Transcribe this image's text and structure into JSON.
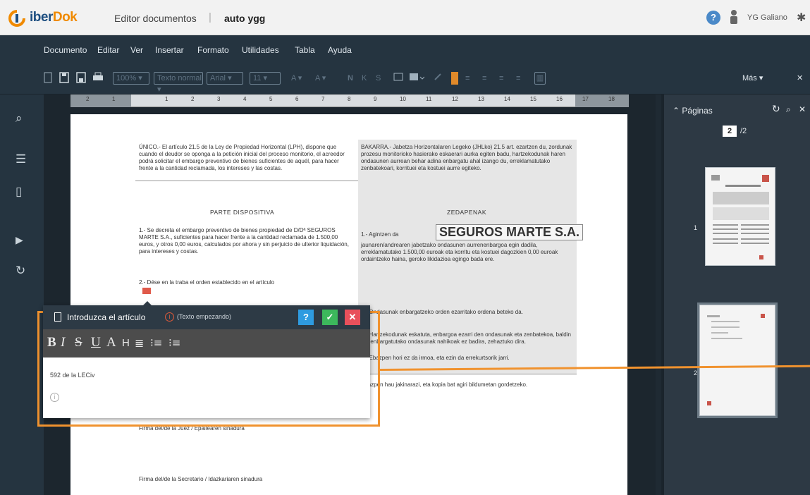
{
  "app": {
    "logo_main": "iber",
    "logo_accent": "Dok",
    "title": "Editor documentos",
    "separator": "|",
    "document_name": "auto ygg",
    "user_name": "YG Galiano"
  },
  "menu": [
    "Documento",
    "Editar",
    "Ver",
    "Insertar",
    "Formato",
    "Utilidades",
    "Tabla",
    "Ayuda"
  ],
  "toolbar": {
    "zoom": "100%",
    "style": "Texto normal",
    "font": "Arial",
    "size": "11",
    "right_label": "Más"
  },
  "ruler": [
    "2",
    "1",
    "1",
    "2",
    "3",
    "4",
    "5",
    "6",
    "7",
    "8",
    "9",
    "10",
    "11",
    "12",
    "13",
    "14",
    "15",
    "16",
    "17",
    "18"
  ],
  "document": {
    "left_intro": "ÚNICO.- El artículo 21.5 de la Ley de Propiedad Horizontal (LPH), dispone que cuando el deudor se oponga a la petición inicial del proceso monitorio, el acreedor podrá solicitar el embargo preventivo de bienes suficientes de aquél, para hacer frente a la cantidad reclamada, los intereses y las costas.",
    "right_intro": "BAKARRA.- Jabetza Horizontalaren Legeko (JHLko) 21.5 art. ezartzen du, zordunak prozesu monitorioko hasierako eskaerari aurka egiten badu, hartzekodunak haren ondasunen aurrean behar adina enbargatu ahal izango du, erreklamatutako zenbatekoari, korrituei eta kostuei aurre egiteko.",
    "left_heading": "PARTE DISPOSITIVA",
    "right_heading": "ZEDAPENAK",
    "left_p1": "1.- Se decreta el embargo preventivo de bienes propiedad de D/Dª SEGUROS MARTE S.A., suficientes para hacer frente a la cantidad reclamada de 1.500,00 euros, y otros 0,00 euros, calculados por ahora y sin perjuicio de ulterior liquidación, para intereses y costas.",
    "right_p1_prefix": "1.- Agintzen da",
    "company": "SEGUROS MARTE S.A.",
    "right_p1_suffix": "jaunaren/andrearen jabetzako ondasunen aurrenenbargoa egin dadila, erreklamatutako 1.500,00 euroak eta korritu eta kostuei dagozkien 0,00 euroak ordaintzeko haina, geroko likidazioa egingo bada ere.",
    "left_p2": "2.- Dése en la traba el orden establecido en el artículo",
    "right_p2": "2.- Ondasunak enbargatzeko orden ezarritako ordena beteko da.",
    "right_p3": "3.- Hartzekodunak eskatuta, enbargoa ezarri den ondasunak eta zenbatekoa, baldin eta enbargatutako ondasunak nahikoak ez badira, zehaztuko dira.",
    "right_p4": "4.- Ebazpen hori ez da irmoa, eta ezin da errekurtsorik jarri.",
    "right_p5": "Ebazpen hau jakinarazi, eta kopia bat agiri bildumetan gordetzeko.",
    "sign1": "Firma del/de la Juez / Epailearen sinadura",
    "sign2": "Firma del/de la Secretario / Idazkariaren sinadura"
  },
  "popup": {
    "title": "Introduzca el artículo",
    "info_glyph": "i",
    "status": "(Texto empezando)",
    "help_glyph": "?",
    "ok_glyph": "✓",
    "close_glyph": "✕",
    "format_buttons": [
      "B",
      "I",
      "S",
      "U",
      "A",
      "H",
      "≣",
      "⁝≡",
      "⁝≡"
    ],
    "content": "592 de la LECiv",
    "bottom_info_glyph": "i"
  },
  "pages_panel": {
    "title": "Páginas",
    "current_page": "2",
    "total_pages": "/2",
    "thumbs": [
      {
        "label": "1"
      },
      {
        "label": "2"
      }
    ]
  },
  "colors": {
    "highlight": "#f0922e",
    "dark_bg": "#253440",
    "ok": "#3cb85c",
    "help": "#2e9be0",
    "close": "#e8505b"
  }
}
